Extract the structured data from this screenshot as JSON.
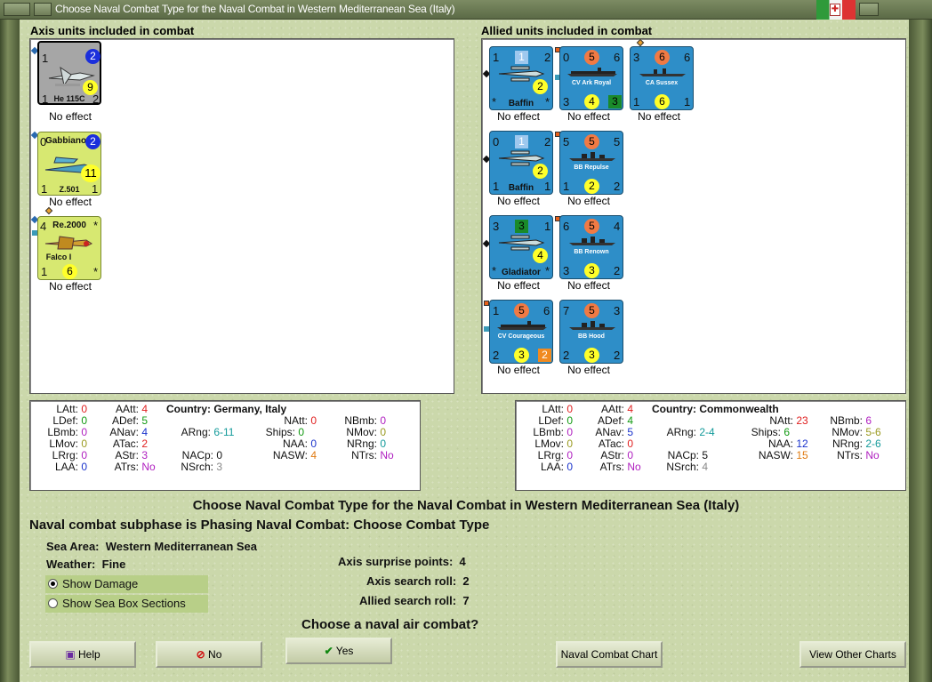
{
  "window": {
    "title": "Choose Naval Combat Type for the Naval Combat in Western Mediterranean Sea (Italy)"
  },
  "axis": {
    "heading": "Axis units included in combat",
    "units": [
      {
        "name": "He 115C",
        "tl": "1",
        "tr": "2",
        "mid": "9",
        "bl": "1",
        "br": "2",
        "effect": "No effect"
      },
      {
        "name": "Z.501",
        "title": "Gabbiano",
        "tl": "0",
        "tr": "2",
        "mid": "11",
        "bl": "1",
        "br": "1",
        "effect": "No effect"
      },
      {
        "name": "Falco I",
        "title": "Re.2000",
        "tl": "4",
        "tr": "*",
        "bl": "1",
        "bm": "6",
        "br": "*",
        "effect": "No effect"
      }
    ],
    "stats": {
      "LAtt": "0",
      "LDef": "0",
      "LBmb": "0",
      "LMov": "0",
      "LRrg": "0",
      "LAA": "0",
      "AAtt": "4",
      "ADef": "5",
      "ANav": "4",
      "ATac": "2",
      "AStr": "3",
      "ATrs": "No",
      "country_label": "Country:",
      "country": "Germany, Italy",
      "ARng": "6-11",
      "NACp": "0",
      "NSrch": "3",
      "NAtt": "0",
      "Ships": "0",
      "NAA": "0",
      "NASW": "4",
      "NBmb": "0",
      "NMov": "0",
      "NRng": "0",
      "NTrs": "No"
    }
  },
  "allied": {
    "heading": "Allied units included in combat",
    "units": [
      {
        "name": "Baffin",
        "tl": "1",
        "tm": "1",
        "tr": "2",
        "mid": "2",
        "bl": "*",
        "br": "*",
        "effect": "No effect"
      },
      {
        "name": "CV Ark Royal",
        "tl": "0",
        "tm": "5",
        "tr": "6",
        "bl": "3",
        "bm": "4",
        "br": "3",
        "effect": "No effect"
      },
      {
        "name": "CA Sussex",
        "tl": "3",
        "tm": "6",
        "tr": "6",
        "bl": "1",
        "bm": "6",
        "br": "1",
        "effect": "No effect"
      },
      {
        "name": "Baffin",
        "tl": "0",
        "tm": "1",
        "tr": "2",
        "mid": "2",
        "bl": "1",
        "br": "1",
        "effect": "No effect"
      },
      {
        "name": "BB Repulse",
        "tl": "5",
        "tm": "5",
        "tr": "5",
        "bl": "1",
        "bm": "2",
        "br": "2",
        "effect": "No effect"
      },
      {
        "name": "Gladiator",
        "tl": "3",
        "tm": "3",
        "tr": "1",
        "mid": "4",
        "bl": "*",
        "br": "*",
        "effect": "No effect"
      },
      {
        "name": "BB Renown",
        "tl": "6",
        "tm": "5",
        "tr": "4",
        "bl": "3",
        "bm": "3",
        "br": "2",
        "effect": "No effect"
      },
      {
        "name": "CV Courageous",
        "tl": "1",
        "tm": "5",
        "tr": "6",
        "bl": "2",
        "bm": "3",
        "br": "2",
        "effect": "No effect"
      },
      {
        "name": "BB Hood",
        "tl": "7",
        "tm": "5",
        "tr": "3",
        "bl": "2",
        "bm": "3",
        "br": "2",
        "effect": "No effect"
      }
    ],
    "stats": {
      "LAtt": "0",
      "LDef": "0",
      "LBmb": "0",
      "LMov": "0",
      "LRrg": "0",
      "LAA": "0",
      "AAtt": "4",
      "ADef": "4",
      "ANav": "5",
      "ATac": "0",
      "AStr": "0",
      "ATrs": "No",
      "country_label": "Country:",
      "country": "Commonwealth",
      "ARng": "2-4",
      "NACp": "5",
      "NSrch": "4",
      "NAtt": "23",
      "Ships": "6",
      "NAA": "12",
      "NASW": "15",
      "NBmb": "6",
      "NMov": "5-6",
      "NRng": "2-6",
      "NTrs": "No"
    }
  },
  "labels": {
    "LAtt": "LAtt:",
    "LDef": "LDef:",
    "LBmb": "LBmb:",
    "LMov": "LMov:",
    "LRrg": "LRrg:",
    "LAA": "LAA:",
    "AAtt": "AAtt:",
    "ADef": "ADef:",
    "ANav": "ANav:",
    "ATac": "ATac:",
    "AStr": "AStr:",
    "ATrs": "ATrs:",
    "ARng": "ARng:",
    "NACp": "NACp:",
    "NSrch": "NSrch:",
    "NAtt": "NAtt:",
    "Ships": "Ships:",
    "NAA": "NAA:",
    "NASW": "NASW:",
    "NBmb": "NBmb:",
    "NMov": "NMov:",
    "NRng": "NRng:",
    "NTrs": "NTrs:"
  },
  "main": {
    "heading": "Choose Naval Combat Type for the Naval Combat in Western Mediterranean Sea (Italy)",
    "subphase": "Naval combat subphase is Phasing Naval Combat: Choose Combat Type",
    "sea_label": "Sea Area:",
    "sea": "Western Mediterranean Sea",
    "weather_label": "Weather:",
    "weather": "Fine",
    "show_damage": "Show Damage",
    "show_sea_box": "Show Sea Box Sections",
    "surprise_label": "Axis surprise points:",
    "surprise": "4",
    "axis_search_label": "Axis search roll:",
    "axis_search": "2",
    "allied_search_label": "Allied search roll:",
    "allied_search": "7",
    "question": "Choose a naval air combat?"
  },
  "buttons": {
    "help": "Help",
    "no": "No",
    "yes": "Yes",
    "chart": "Naval Combat Chart",
    "other": "View Other Charts"
  },
  "colors": {
    "red": "#e02020",
    "green": "#119911",
    "blue": "#1a33cc",
    "orange": "#e07a10",
    "purple": "#b020c0",
    "teal": "#139a9a",
    "gray": "#888888"
  }
}
